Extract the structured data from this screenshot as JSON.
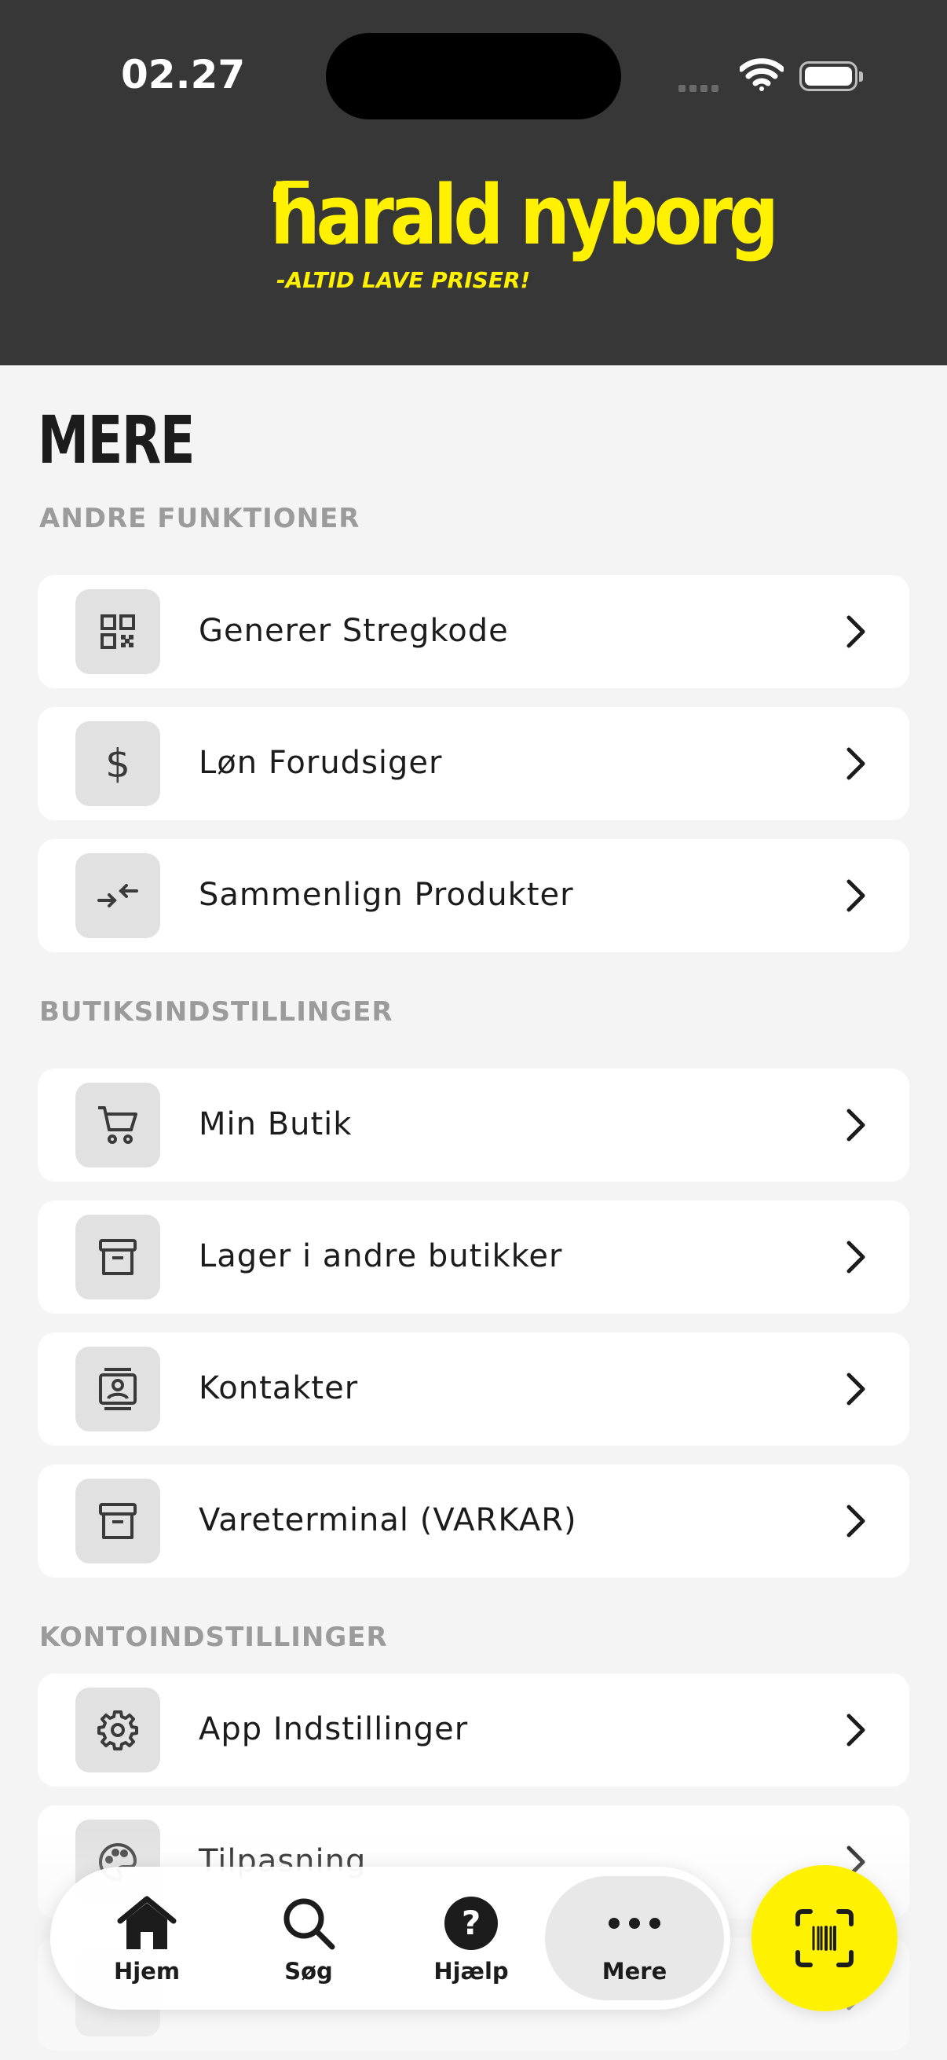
{
  "status_bar": {
    "time": "02.27"
  },
  "brand": {
    "name": "harald nyborg",
    "tagline": "-ALTID LAVE PRISER!",
    "color": "#fff100"
  },
  "page": {
    "title": "MERE"
  },
  "sections": [
    {
      "label": "ANDRE FUNKTIONER",
      "items": [
        {
          "label": "Generer Stregkode",
          "icon": "qr-code-icon"
        },
        {
          "label": "Løn Forudsiger",
          "icon": "dollar-icon"
        },
        {
          "label": "Sammenlign Produkter",
          "icon": "compare-arrows-icon"
        }
      ]
    },
    {
      "label": "BUTIKSINDSTILLINGER",
      "items": [
        {
          "label": "Min Butik",
          "icon": "shopping-cart-icon"
        },
        {
          "label": "Lager i andre butikker",
          "icon": "archive-box-icon"
        },
        {
          "label": "Kontakter",
          "icon": "contact-card-icon"
        },
        {
          "label": "Vareterminal (VARKAR)",
          "icon": "archive-box-icon"
        }
      ]
    },
    {
      "label": "KONTOINDSTILLINGER",
      "items": [
        {
          "label": "App Indstillinger",
          "icon": "gear-icon"
        },
        {
          "label": "Tilpasning",
          "icon": "palette-icon"
        }
      ]
    }
  ],
  "tabbar": {
    "tabs": [
      {
        "label": "Hjem",
        "icon": "home-icon"
      },
      {
        "label": "Søg",
        "icon": "search-icon"
      },
      {
        "label": "Hjælp",
        "icon": "help-icon"
      },
      {
        "label": "Mere",
        "icon": "more-icon",
        "active": true
      }
    ],
    "scan_button": {
      "icon": "barcode-scan-icon",
      "color": "#fff200"
    }
  }
}
